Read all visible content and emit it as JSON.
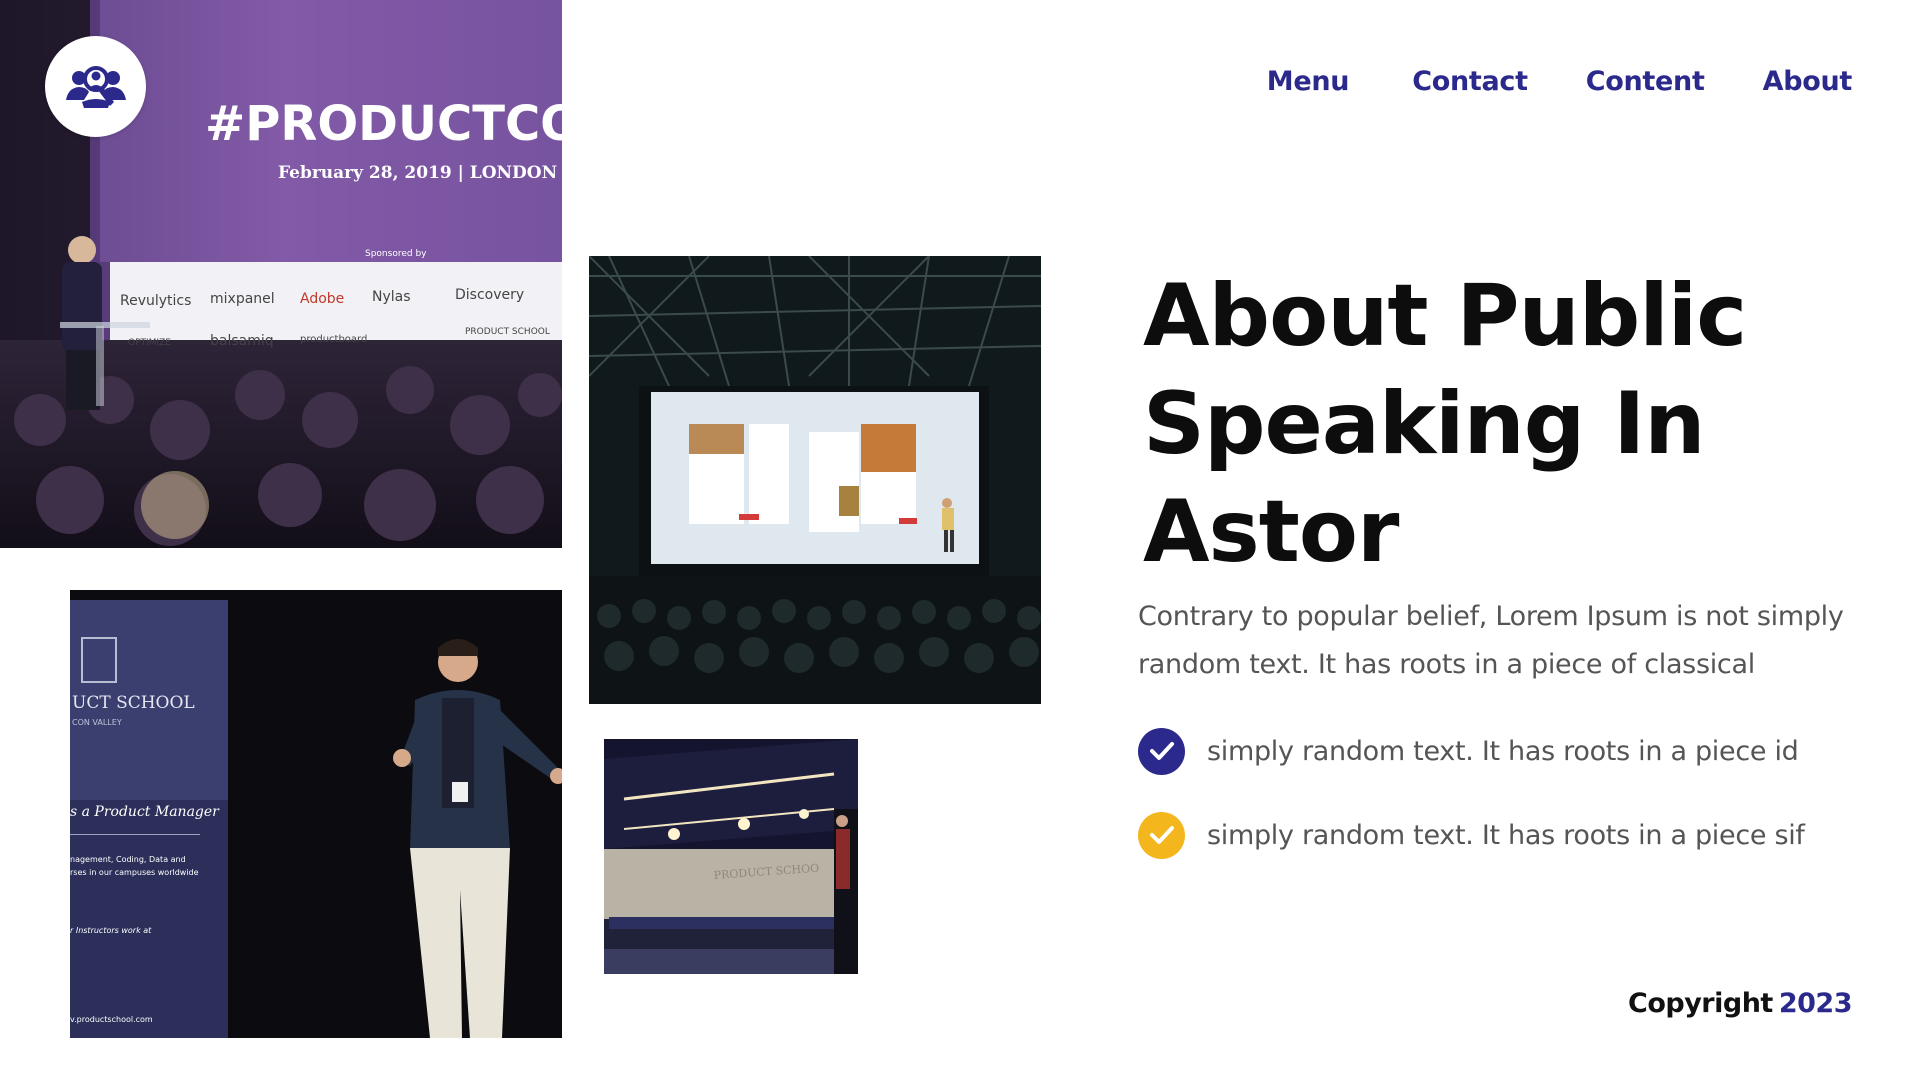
{
  "colors": {
    "accent": "#2b2a8c",
    "check_primary": "#2b2a8c",
    "check_secondary": "#f3b61c",
    "title": "#0d0d0d",
    "body": "#555555"
  },
  "logo": {
    "icon": "team-search-icon"
  },
  "nav": {
    "items": [
      {
        "label": "Menu"
      },
      {
        "label": "Contact"
      },
      {
        "label": "Content"
      },
      {
        "label": "About"
      }
    ]
  },
  "hero": {
    "title_line1": "About Public",
    "title_line2": "Speaking In",
    "title_line3": "Astor",
    "body": "Contrary to popular belief, Lorem Ipsum is not simply random text. It has roots in a piece of classical",
    "checklist": [
      {
        "text": "simply random text. It has roots in a piece id",
        "icon": "check-circle-icon"
      },
      {
        "text": "simply random text. It has roots in a piece sif",
        "icon": "check-circle-icon"
      }
    ]
  },
  "footer": {
    "copyright_label": "Copyright",
    "copyright_year": "2023"
  },
  "photos": {
    "photo1": {
      "banner_title": "#PRODUCTCO",
      "banner_date": "February 28, 2019  |  LONDON",
      "sponsored": "Sponsored by",
      "sponsors": [
        "Revulytics",
        "mixpanel",
        "Adobe",
        "Nylas",
        "Discovery",
        "OPTIMIZE",
        "balsamiq",
        "productboard",
        "PRODUCT SCHOOL"
      ]
    },
    "photo3": {
      "banner_line1": "UCT SCHOOL",
      "banner_line2": "CON VALLEY",
      "banner_line3": "s a Product Manager",
      "banner_line4": "nagement, Coding, Data and",
      "banner_line5": "rses in our campuses worldwide",
      "banner_line6": "r Instructors work at",
      "banner_url": "v.productschool.com"
    },
    "photo4": {
      "wall_text": "PRODUCT SCHOO"
    }
  }
}
